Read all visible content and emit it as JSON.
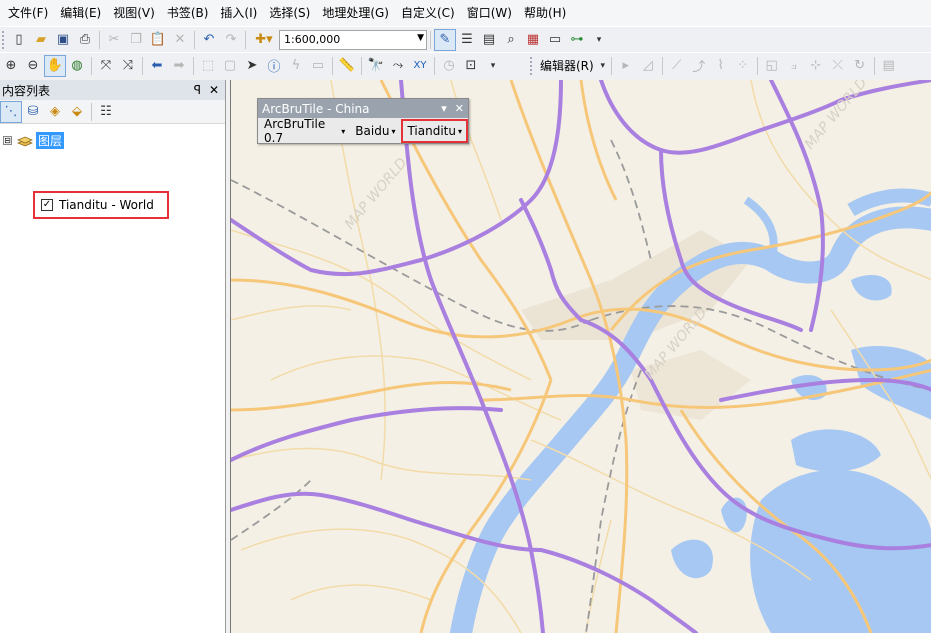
{
  "menu": [
    "文件(F)",
    "编辑(E)",
    "视图(V)",
    "书签(B)",
    "插入(I)",
    "选择(S)",
    "地理处理(G)",
    "自定义(C)",
    "窗口(W)",
    "帮助(H)"
  ],
  "toolbar": {
    "scale_value": "1:600,000",
    "editor_label": "编辑器(R)"
  },
  "toc": {
    "title": "内容列表",
    "pin": "ꟼ",
    "close": "✕",
    "group": {
      "expander": "⊟",
      "label": "图层"
    },
    "layer": {
      "checked": "✓",
      "label": "Tianditu - World"
    }
  },
  "arcbrutile": {
    "title": "ArcBruTile - China",
    "version": "ArcBruTile 0.7",
    "provider1": "Baidu",
    "provider2": "Tianditu",
    "caret": "▾",
    "close": "✕"
  },
  "map": {
    "watermark": "MAP WORLD",
    "colors": {
      "background": "#f4f0e6",
      "water": "#a6c8f2",
      "highway": "#a97fe0",
      "major_road": "#f7c779",
      "minor_road": "#f3dba8",
      "rail": "#9a9a9a",
      "urban": "#ebe4d4"
    }
  }
}
